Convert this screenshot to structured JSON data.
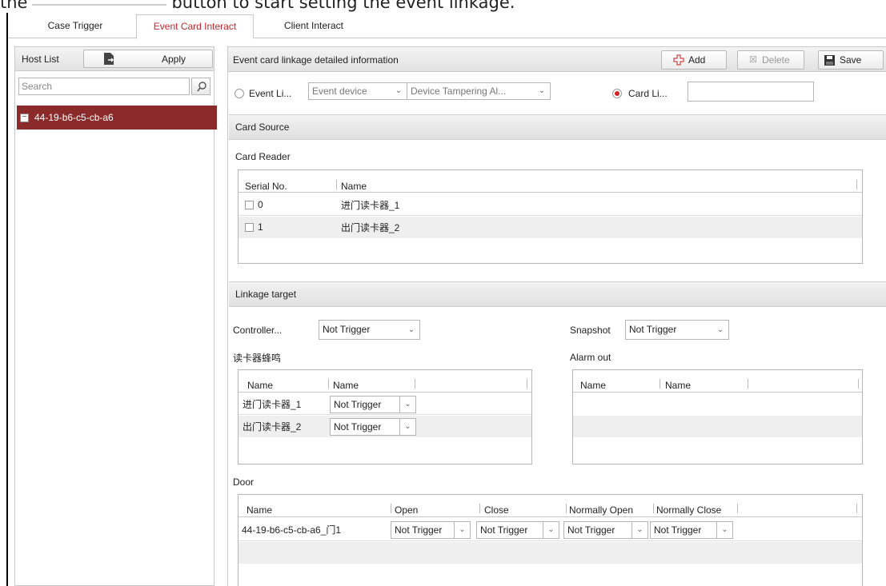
{
  "doc": {
    "text_left": "the",
    "text_right": "button to start setting the event linkage."
  },
  "tabs": [
    {
      "label": "Case Trigger"
    },
    {
      "label": "Event Card Interact"
    },
    {
      "label": "Client Interact"
    }
  ],
  "host_list": {
    "title": "Host List",
    "apply_label": "Apply",
    "search_placeholder": "Search",
    "hosts": [
      "44-19-b6-c5-cb-a6"
    ]
  },
  "detail": {
    "title": "Event card linkage detailed information",
    "add_label": "Add",
    "delete_label": "Delete",
    "save_label": "Save",
    "event_linkage_label": "Event Li...",
    "event_device_value": "Event device",
    "event_type_value": "Device Tampering Al...",
    "card_linkage_label": "Card Li...",
    "card_linkage_value": ""
  },
  "card_source": {
    "title": "Card Source",
    "card_reader_label": "Card Reader",
    "columns": [
      "Serial No.",
      "Name"
    ],
    "rows": [
      {
        "serial": "0",
        "name": "进门读卡器_1"
      },
      {
        "serial": "1",
        "name": "出门读卡器_2"
      }
    ]
  },
  "linkage_target": {
    "title": "Linkage target",
    "controller_label": "Controller...",
    "controller_value": "Not Trigger",
    "snapshot_label": "Snapshot",
    "snapshot_value": "Not Trigger",
    "buzzer_label": "读卡器蜂鸣",
    "buzzer_columns": [
      "Name",
      "Name"
    ],
    "buzzer_rows": [
      {
        "name": "进门读卡器_1",
        "value": "Not Trigger"
      },
      {
        "name": "出门读卡器_2",
        "value": "Not Trigger"
      }
    ],
    "alarm_out_label": "Alarm out",
    "alarm_columns": [
      "Name",
      "Name"
    ],
    "door_label": "Door",
    "door_columns": [
      "Name",
      "Open",
      "Close",
      "Normally Open",
      "Normally Close"
    ],
    "door_rows": [
      {
        "name": "44-19-b6-c5-cb-a6_门1",
        "open": "Not Trigger",
        "close": "Not Trigger",
        "normally_open": "Not Trigger",
        "normally_close": "Not Trigger"
      }
    ]
  },
  "colors": {
    "accent_red": "#c0272d",
    "selected_host_bg": "#8b2a2a"
  }
}
